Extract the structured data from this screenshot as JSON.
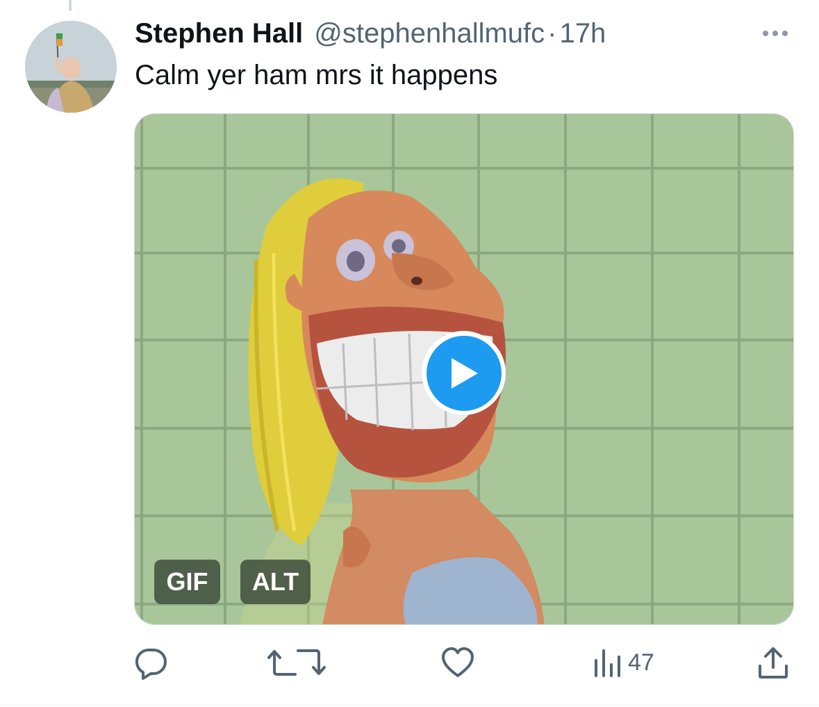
{
  "tweet": {
    "author": {
      "display_name": "Stephen Hall",
      "handle": "@stephenhallmufc"
    },
    "separator": "·",
    "timestamp": "17h",
    "text": "Calm yer ham mrs it happens"
  },
  "media": {
    "type": "GIF",
    "badges": {
      "gif_label": "GIF",
      "alt_label": "ALT"
    },
    "icon": "play-icon"
  },
  "actions": {
    "reply_icon": "reply-icon",
    "retweet_icon": "retweet-icon",
    "like_icon": "heart-icon",
    "views_icon": "views-icon",
    "views_count": "47",
    "share_icon": "share-icon"
  },
  "colors": {
    "accent": "#1d9bf0",
    "text_primary": "#0f1419",
    "text_secondary": "#536471",
    "badge_bg": "#404e3c"
  }
}
